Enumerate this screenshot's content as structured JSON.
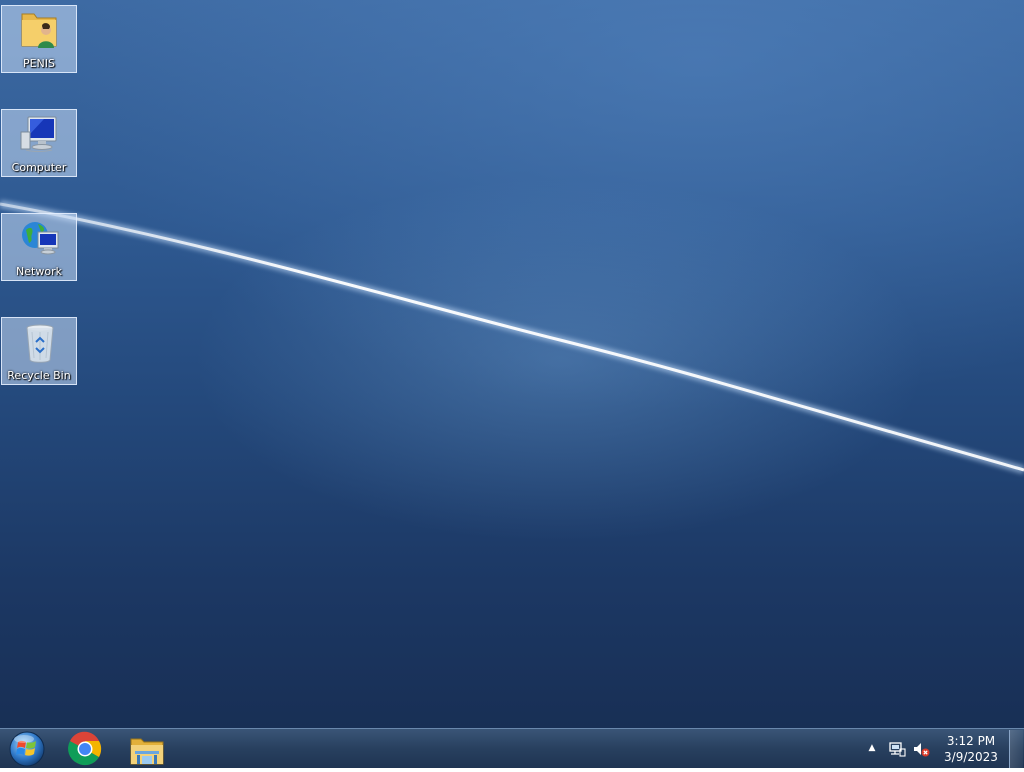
{
  "desktop": {
    "icons": [
      {
        "label": "PENIS",
        "icon": "user-folder-icon"
      },
      {
        "label": "Computer",
        "icon": "computer-icon"
      },
      {
        "label": "Network",
        "icon": "network-icon"
      },
      {
        "label": "Recycle Bin",
        "icon": "recycle-bin-icon"
      }
    ]
  },
  "taskbar": {
    "start_icon": "windows-start-orb-icon",
    "pinned": [
      {
        "icon": "chrome-icon"
      },
      {
        "icon": "file-explorer-icon"
      }
    ],
    "tray": {
      "show_hidden_icon": "up-arrow-icon",
      "network_icon": "network-status-icon",
      "volume_icon": "volume-muted-icon"
    },
    "clock": {
      "time": "3:12 PM",
      "date": "3/9/2023"
    }
  },
  "colors": {
    "desktop_top": "#3d6aa3",
    "desktop_bottom": "#182f55",
    "taskbar": "#28405f"
  }
}
